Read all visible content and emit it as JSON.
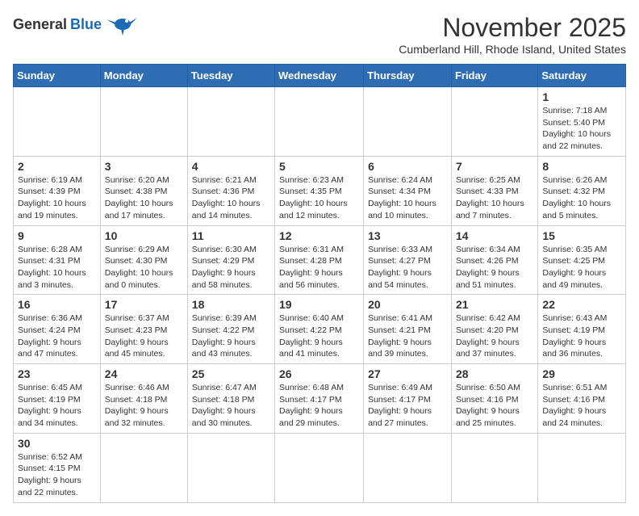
{
  "header": {
    "logo_general": "General",
    "logo_blue": "Blue",
    "month_title": "November 2025",
    "location": "Cumberland Hill, Rhode Island, United States"
  },
  "weekdays": [
    "Sunday",
    "Monday",
    "Tuesday",
    "Wednesday",
    "Thursday",
    "Friday",
    "Saturday"
  ],
  "weeks": [
    [
      {
        "day": "",
        "info": ""
      },
      {
        "day": "",
        "info": ""
      },
      {
        "day": "",
        "info": ""
      },
      {
        "day": "",
        "info": ""
      },
      {
        "day": "",
        "info": ""
      },
      {
        "day": "",
        "info": ""
      },
      {
        "day": "1",
        "info": "Sunrise: 7:18 AM\nSunset: 5:40 PM\nDaylight: 10 hours and 22 minutes."
      }
    ],
    [
      {
        "day": "2",
        "info": "Sunrise: 6:19 AM\nSunset: 4:39 PM\nDaylight: 10 hours and 19 minutes."
      },
      {
        "day": "3",
        "info": "Sunrise: 6:20 AM\nSunset: 4:38 PM\nDaylight: 10 hours and 17 minutes."
      },
      {
        "day": "4",
        "info": "Sunrise: 6:21 AM\nSunset: 4:36 PM\nDaylight: 10 hours and 14 minutes."
      },
      {
        "day": "5",
        "info": "Sunrise: 6:23 AM\nSunset: 4:35 PM\nDaylight: 10 hours and 12 minutes."
      },
      {
        "day": "6",
        "info": "Sunrise: 6:24 AM\nSunset: 4:34 PM\nDaylight: 10 hours and 10 minutes."
      },
      {
        "day": "7",
        "info": "Sunrise: 6:25 AM\nSunset: 4:33 PM\nDaylight: 10 hours and 7 minutes."
      },
      {
        "day": "8",
        "info": "Sunrise: 6:26 AM\nSunset: 4:32 PM\nDaylight: 10 hours and 5 minutes."
      }
    ],
    [
      {
        "day": "9",
        "info": "Sunrise: 6:28 AM\nSunset: 4:31 PM\nDaylight: 10 hours and 3 minutes."
      },
      {
        "day": "10",
        "info": "Sunrise: 6:29 AM\nSunset: 4:30 PM\nDaylight: 10 hours and 0 minutes."
      },
      {
        "day": "11",
        "info": "Sunrise: 6:30 AM\nSunset: 4:29 PM\nDaylight: 9 hours and 58 minutes."
      },
      {
        "day": "12",
        "info": "Sunrise: 6:31 AM\nSunset: 4:28 PM\nDaylight: 9 hours and 56 minutes."
      },
      {
        "day": "13",
        "info": "Sunrise: 6:33 AM\nSunset: 4:27 PM\nDaylight: 9 hours and 54 minutes."
      },
      {
        "day": "14",
        "info": "Sunrise: 6:34 AM\nSunset: 4:26 PM\nDaylight: 9 hours and 51 minutes."
      },
      {
        "day": "15",
        "info": "Sunrise: 6:35 AM\nSunset: 4:25 PM\nDaylight: 9 hours and 49 minutes."
      }
    ],
    [
      {
        "day": "16",
        "info": "Sunrise: 6:36 AM\nSunset: 4:24 PM\nDaylight: 9 hours and 47 minutes."
      },
      {
        "day": "17",
        "info": "Sunrise: 6:37 AM\nSunset: 4:23 PM\nDaylight: 9 hours and 45 minutes."
      },
      {
        "day": "18",
        "info": "Sunrise: 6:39 AM\nSunset: 4:22 PM\nDaylight: 9 hours and 43 minutes."
      },
      {
        "day": "19",
        "info": "Sunrise: 6:40 AM\nSunset: 4:22 PM\nDaylight: 9 hours and 41 minutes."
      },
      {
        "day": "20",
        "info": "Sunrise: 6:41 AM\nSunset: 4:21 PM\nDaylight: 9 hours and 39 minutes."
      },
      {
        "day": "21",
        "info": "Sunrise: 6:42 AM\nSunset: 4:20 PM\nDaylight: 9 hours and 37 minutes."
      },
      {
        "day": "22",
        "info": "Sunrise: 6:43 AM\nSunset: 4:19 PM\nDaylight: 9 hours and 36 minutes."
      }
    ],
    [
      {
        "day": "23",
        "info": "Sunrise: 6:45 AM\nSunset: 4:19 PM\nDaylight: 9 hours and 34 minutes."
      },
      {
        "day": "24",
        "info": "Sunrise: 6:46 AM\nSunset: 4:18 PM\nDaylight: 9 hours and 32 minutes."
      },
      {
        "day": "25",
        "info": "Sunrise: 6:47 AM\nSunset: 4:18 PM\nDaylight: 9 hours and 30 minutes."
      },
      {
        "day": "26",
        "info": "Sunrise: 6:48 AM\nSunset: 4:17 PM\nDaylight: 9 hours and 29 minutes."
      },
      {
        "day": "27",
        "info": "Sunrise: 6:49 AM\nSunset: 4:17 PM\nDaylight: 9 hours and 27 minutes."
      },
      {
        "day": "28",
        "info": "Sunrise: 6:50 AM\nSunset: 4:16 PM\nDaylight: 9 hours and 25 minutes."
      },
      {
        "day": "29",
        "info": "Sunrise: 6:51 AM\nSunset: 4:16 PM\nDaylight: 9 hours and 24 minutes."
      }
    ],
    [
      {
        "day": "30",
        "info": "Sunrise: 6:52 AM\nSunset: 4:15 PM\nDaylight: 9 hours and 22 minutes."
      },
      {
        "day": "",
        "info": ""
      },
      {
        "day": "",
        "info": ""
      },
      {
        "day": "",
        "info": ""
      },
      {
        "day": "",
        "info": ""
      },
      {
        "day": "",
        "info": ""
      },
      {
        "day": "",
        "info": ""
      }
    ]
  ]
}
